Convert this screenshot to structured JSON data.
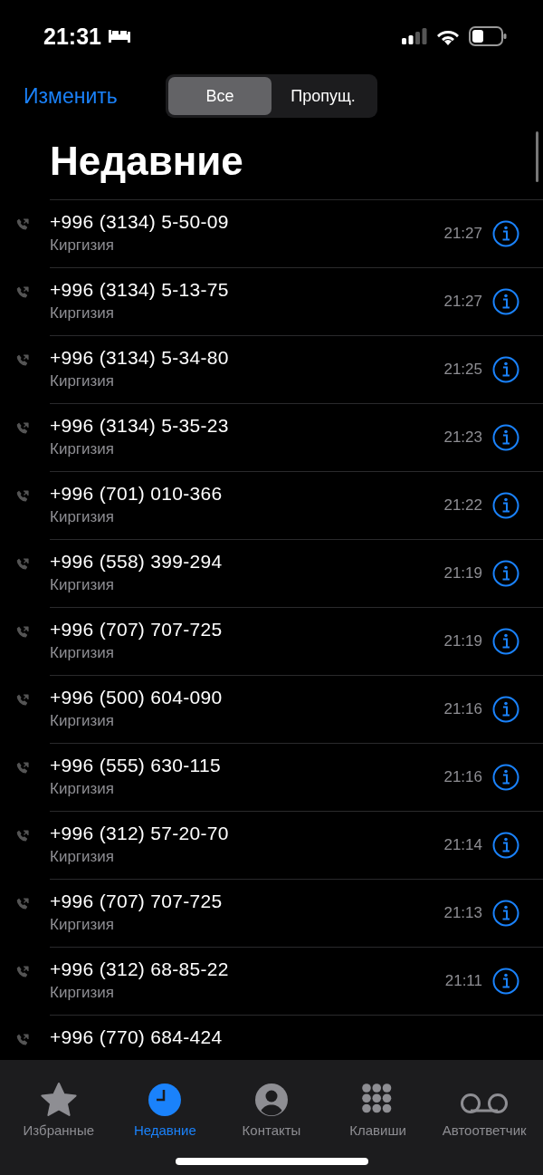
{
  "status_bar": {
    "time": "21:31"
  },
  "nav": {
    "edit": "Изменить",
    "segments": [
      {
        "label": "Все",
        "selected": true
      },
      {
        "label": "Пропущ.",
        "selected": false
      }
    ]
  },
  "title": "Недавние",
  "calls": [
    {
      "number": "+996 (3134) 5-50-09",
      "country": "Киргизия",
      "time": "21:27"
    },
    {
      "number": "+996 (3134) 5-13-75",
      "country": "Киргизия",
      "time": "21:27"
    },
    {
      "number": "+996 (3134) 5-34-80",
      "country": "Киргизия",
      "time": "21:25"
    },
    {
      "number": "+996 (3134) 5-35-23",
      "country": "Киргизия",
      "time": "21:23"
    },
    {
      "number": "+996 (701) 010-366",
      "country": "Киргизия",
      "time": "21:22"
    },
    {
      "number": "+996 (558) 399-294",
      "country": "Киргизия",
      "time": "21:19"
    },
    {
      "number": "+996 (707) 707-725",
      "country": "Киргизия",
      "time": "21:19"
    },
    {
      "number": "+996 (500) 604-090",
      "country": "Киргизия",
      "time": "21:16"
    },
    {
      "number": "+996 (555) 630-115",
      "country": "Киргизия",
      "time": "21:16"
    },
    {
      "number": "+996 (312) 57-20-70",
      "country": "Киргизия",
      "time": "21:14"
    },
    {
      "number": "+996 (707) 707-725",
      "country": "Киргизия",
      "time": "21:13"
    },
    {
      "number": "+996 (312) 68-85-22",
      "country": "Киргизия",
      "time": "21:11"
    },
    {
      "number": "+996 (770) 684-424"
    }
  ],
  "tab_bar": [
    {
      "kind": "star",
      "label": "Избранные",
      "selected": false
    },
    {
      "kind": "clock",
      "label": "Недавние",
      "selected": true
    },
    {
      "kind": "person",
      "label": "Контакты",
      "selected": false
    },
    {
      "kind": "keypad",
      "label": "Клавиши",
      "selected": false
    },
    {
      "kind": "voicemail",
      "label": "Автоответчик",
      "selected": false
    }
  ]
}
